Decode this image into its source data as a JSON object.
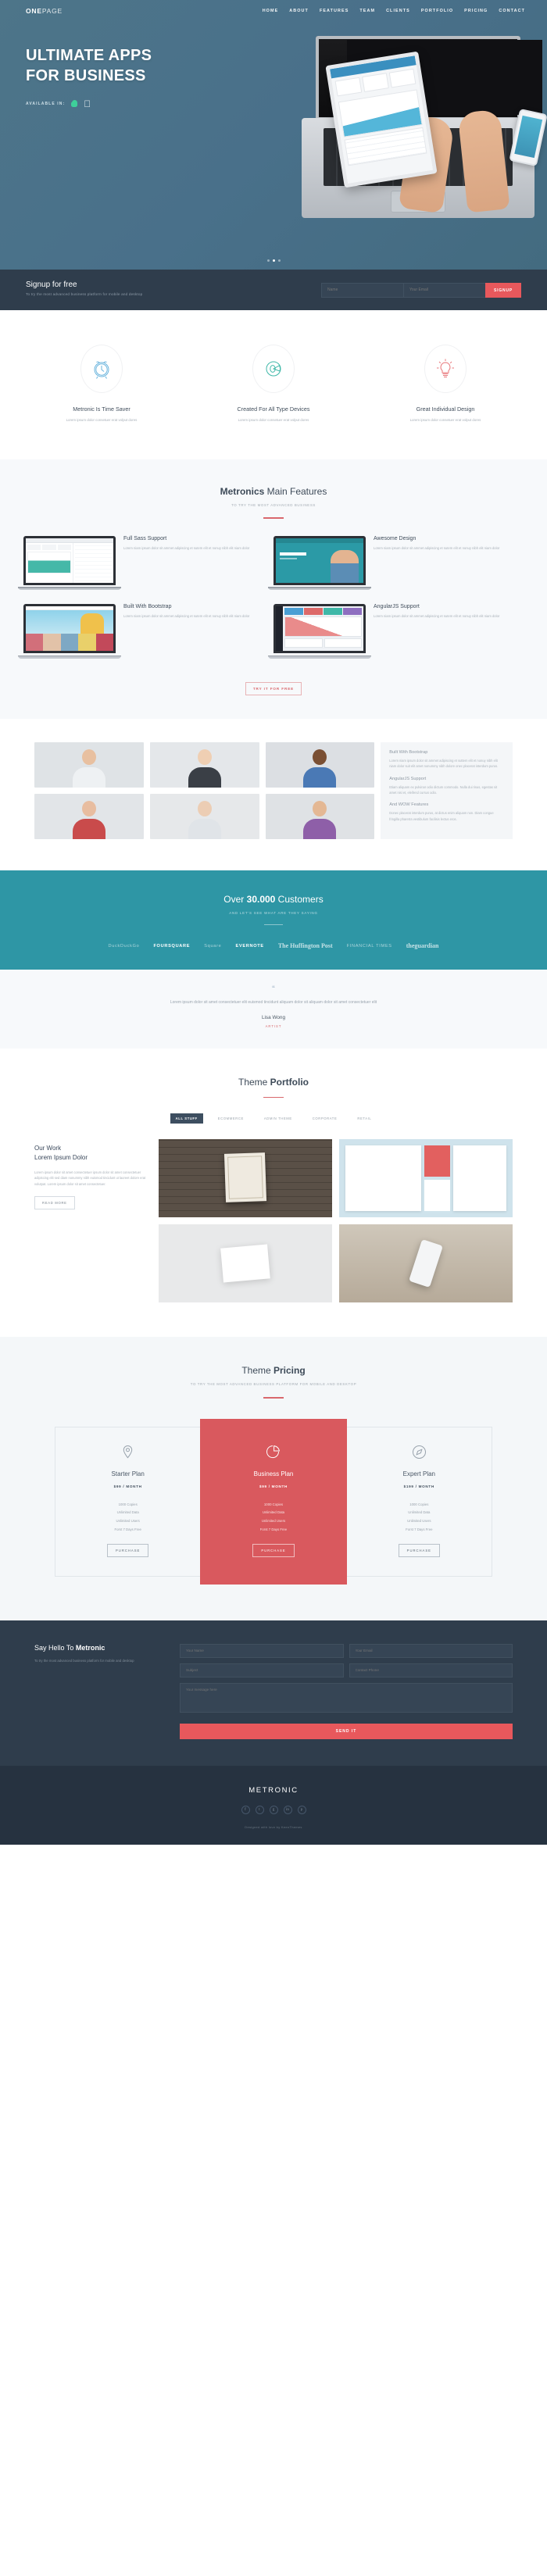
{
  "header": {
    "logo_bold": "ONE",
    "logo_light": "PAGE",
    "nav": [
      "HOME",
      "ABOUT",
      "FEATURES",
      "TEAM",
      "CLIENTS",
      "PORTFOLIO",
      "PRICING",
      "CONTACT"
    ]
  },
  "hero": {
    "line1": "ULTIMATE APPS",
    "line2": "FOR BUSINESS",
    "available_label": "AVAILABLE IN:",
    "android_icon": "android-icon",
    "apple_icon": "apple-icon",
    "apple_glyph": ""
  },
  "signup": {
    "title": "Signup for free",
    "subtitle": "To try the most advanced business platform for mobile and desktop",
    "name_placeholder": "Name",
    "email_placeholder": "Your Email",
    "button": "SIGNUP"
  },
  "features3": [
    {
      "icon": "alarm-clock-icon",
      "title": "Metronic Is Time Saver",
      "text": "Lorem ipsum dolor consetuer erat volput dores"
    },
    {
      "icon": "devices-pie-icon",
      "title": "Created For All Type Devices",
      "text": "Lorem ipsum dolor consetuer erat volput dores"
    },
    {
      "icon": "lightbulb-icon",
      "title": "Great Individual Design",
      "text": "Lorem ipsum dolor consetuer erat volput dores"
    }
  ],
  "main_features": {
    "title_bold": "Metronics",
    "title_light": " Main Features",
    "subtitle": "TO TRY THE MOST ADVANCED BUSINESS",
    "items": [
      {
        "title": "Full Sass Support",
        "text": "Lorem niam ipsum dolor sit ammet adipiscing et sutem elit et nonuy nibh elit niam dolor",
        "screen": "dashboard"
      },
      {
        "title": "Awesome Design",
        "text": "Lorem niam ipsum dolor sit ammet adipiscing et sutem elit et nonuy nibh elit niam dolor",
        "screen": "teal-landing"
      },
      {
        "title": "Built With Bootstrap",
        "text": "Lorem niam ipsum dolor sit ammet adipiscing et sutem elit et nonuy nibh elit niam dolor",
        "screen": "shop"
      },
      {
        "title": "AngularJS Support",
        "text": "Lorem niam ipsum dolor sit ammet adipiscing et sutem elit et nonuy nibh elit niam dolor",
        "screen": "admin"
      }
    ],
    "cta": "TRY IT FOR FREE"
  },
  "team": {
    "photos": [
      {
        "name": "team-member-1",
        "bg": "#dfe3e6",
        "skin": "#e8c0a0",
        "shirt": "#eef1f3"
      },
      {
        "name": "team-member-2",
        "bg": "#e4e7ea",
        "skin": "#efcfb3",
        "shirt": "#3a3f46"
      },
      {
        "name": "team-member-3",
        "bg": "#dcdfe3",
        "skin": "#7a4f33",
        "shirt": "#4a79b5"
      },
      {
        "name": "team-member-4",
        "bg": "#e2e5e8",
        "skin": "#e8bda0",
        "shirt": "#c94b4b"
      },
      {
        "name": "team-member-5",
        "bg": "#e6e8ea",
        "skin": "#eccdb4",
        "shirt": "#e0e4e8"
      },
      {
        "name": "team-member-6",
        "bg": "#dfe2e5",
        "skin": "#e4b894",
        "shirt": "#8e5fa8"
      }
    ],
    "panel": [
      {
        "title": "Built With Bootstrap",
        "text": "Lorem niam ipsum dolor sit ammet adipiscing et suttem elit et nonuy nibh elit niam dolor suit elit amet nonummy nibh dolore onec placerat interdum purus."
      },
      {
        "title": "AngularJS Support",
        "text": "Etiam aliquam ex pulvinar odio dictum commodo. Nulla dui risus, egestas sit amet nisi et, eleifend cursus odio."
      },
      {
        "title": "And WOW Features",
        "text": "Donec placerat interdum purus, at dictus enim aliquam non. Diam congue fringilla pharetra vestibulum facilisis lectus eros."
      }
    ]
  },
  "customers": {
    "title_light": "Over ",
    "title_bold": "30.000",
    "title_tail": " Customers",
    "subtitle": "AND LET'S SEE WHAT ARE THEY SAYING",
    "logos": [
      {
        "name": "duckduckgo-logo",
        "text": "DuckDuckGo",
        "style": "light"
      },
      {
        "name": "foursquare-logo",
        "text": "FOURSQUARE",
        "style": "strong"
      },
      {
        "name": "square-logo",
        "text": "Square",
        "style": "light"
      },
      {
        "name": "evernote-logo",
        "text": "EVERNOTE",
        "style": "strong"
      },
      {
        "name": "huffington-post-logo",
        "text": "The Huffington Post",
        "style": "serif"
      },
      {
        "name": "financial-times-logo",
        "text": "FINANCIAL TIMES",
        "style": "light"
      },
      {
        "name": "theguardian-logo",
        "text": "theguardian",
        "style": "serif"
      }
    ]
  },
  "testimonial": {
    "quote_mark": "“",
    "text": "Lorem ipsum dolor sit amet consectetuer elit euismod tincidunt aliquam dolor sit aliquam dolor sit amet consectetuer elit",
    "author": "Lisa Wong",
    "role": "ARTIST"
  },
  "portfolio": {
    "title_light": "Theme ",
    "title_bold": "Portfolio",
    "filters": [
      "ALL STUFF",
      "ECOMMERCE",
      "ADMIN THEME",
      "CORPORATE",
      "RETAIL"
    ],
    "active_filter": "ALL STUFF",
    "work_title_bold": "Our Work",
    "work_title_light": "Lorem Ipsum Dolor",
    "work_text": "Lorem ipsum dolor sit amet consectetuer ipsum dolor sit amet consectetuer adipiscing elit sed diam nonummy nibh euismod tincidunt ut laoreet dolore erat volutpat. Lorem ipsum dolor sit amet consectetuer.",
    "work_button": "READ MORE",
    "tiles": [
      {
        "name": "portfolio-tile-signage"
      },
      {
        "name": "portfolio-tile-stationery"
      },
      {
        "name": "portfolio-tile-businesscards"
      },
      {
        "name": "portfolio-tile-mobile"
      }
    ]
  },
  "pricing": {
    "title_light": "Theme ",
    "title_bold": "Pricing",
    "subtitle": "TO TRY THE MOST ADVANCED BUSINESS PLATFORM FOR MOBILE AND DESKTOP",
    "plans": [
      {
        "icon": "map-pin-icon",
        "name": "Starter Plan",
        "price": "$99 / MONTH",
        "features": [
          "1000 Copies",
          "Unlimited Data",
          "Unlimited Users",
          "Forst 7 Days Free"
        ],
        "button": "PURCHASE",
        "featured": false
      },
      {
        "icon": "pie-chart-icon",
        "name": "Business Plan",
        "price": "$99 / MONTH",
        "features": [
          "1000 Copies",
          "Unlimited Data",
          "Unlimited Users",
          "Forst 7 Days Free"
        ],
        "button": "PURCHASE",
        "featured": true
      },
      {
        "icon": "compass-icon",
        "name": "Expert Plan",
        "price": "$199 / MONTH",
        "features": [
          "1000 Copies",
          "Unlimited Data",
          "Unlimited Users",
          "Forst 7 Days Free"
        ],
        "button": "PURCHASE",
        "featured": false
      }
    ]
  },
  "contact": {
    "title_light": "Say Hello To ",
    "title_bold": "Metronic",
    "text": "To try the most advanced business platform for mobile and desktop",
    "name_placeholder": "Your Name",
    "email_placeholder": "Your Email",
    "subject_placeholder": "Subject",
    "phone_placeholder": "Contact Phone",
    "message_placeholder": "Your message here",
    "button": "SEND IT"
  },
  "footer": {
    "logo": "METRONIC",
    "socials": [
      "f",
      "t",
      "g",
      "in",
      "p"
    ],
    "note": "Designed with love by KeenThemes"
  },
  "colors": {
    "hero_bg": "#4a7186",
    "dark": "#2f3d4c",
    "accent_red": "#d9595e",
    "teal": "#2e96a5",
    "light_bg": "#f4f7f9"
  }
}
